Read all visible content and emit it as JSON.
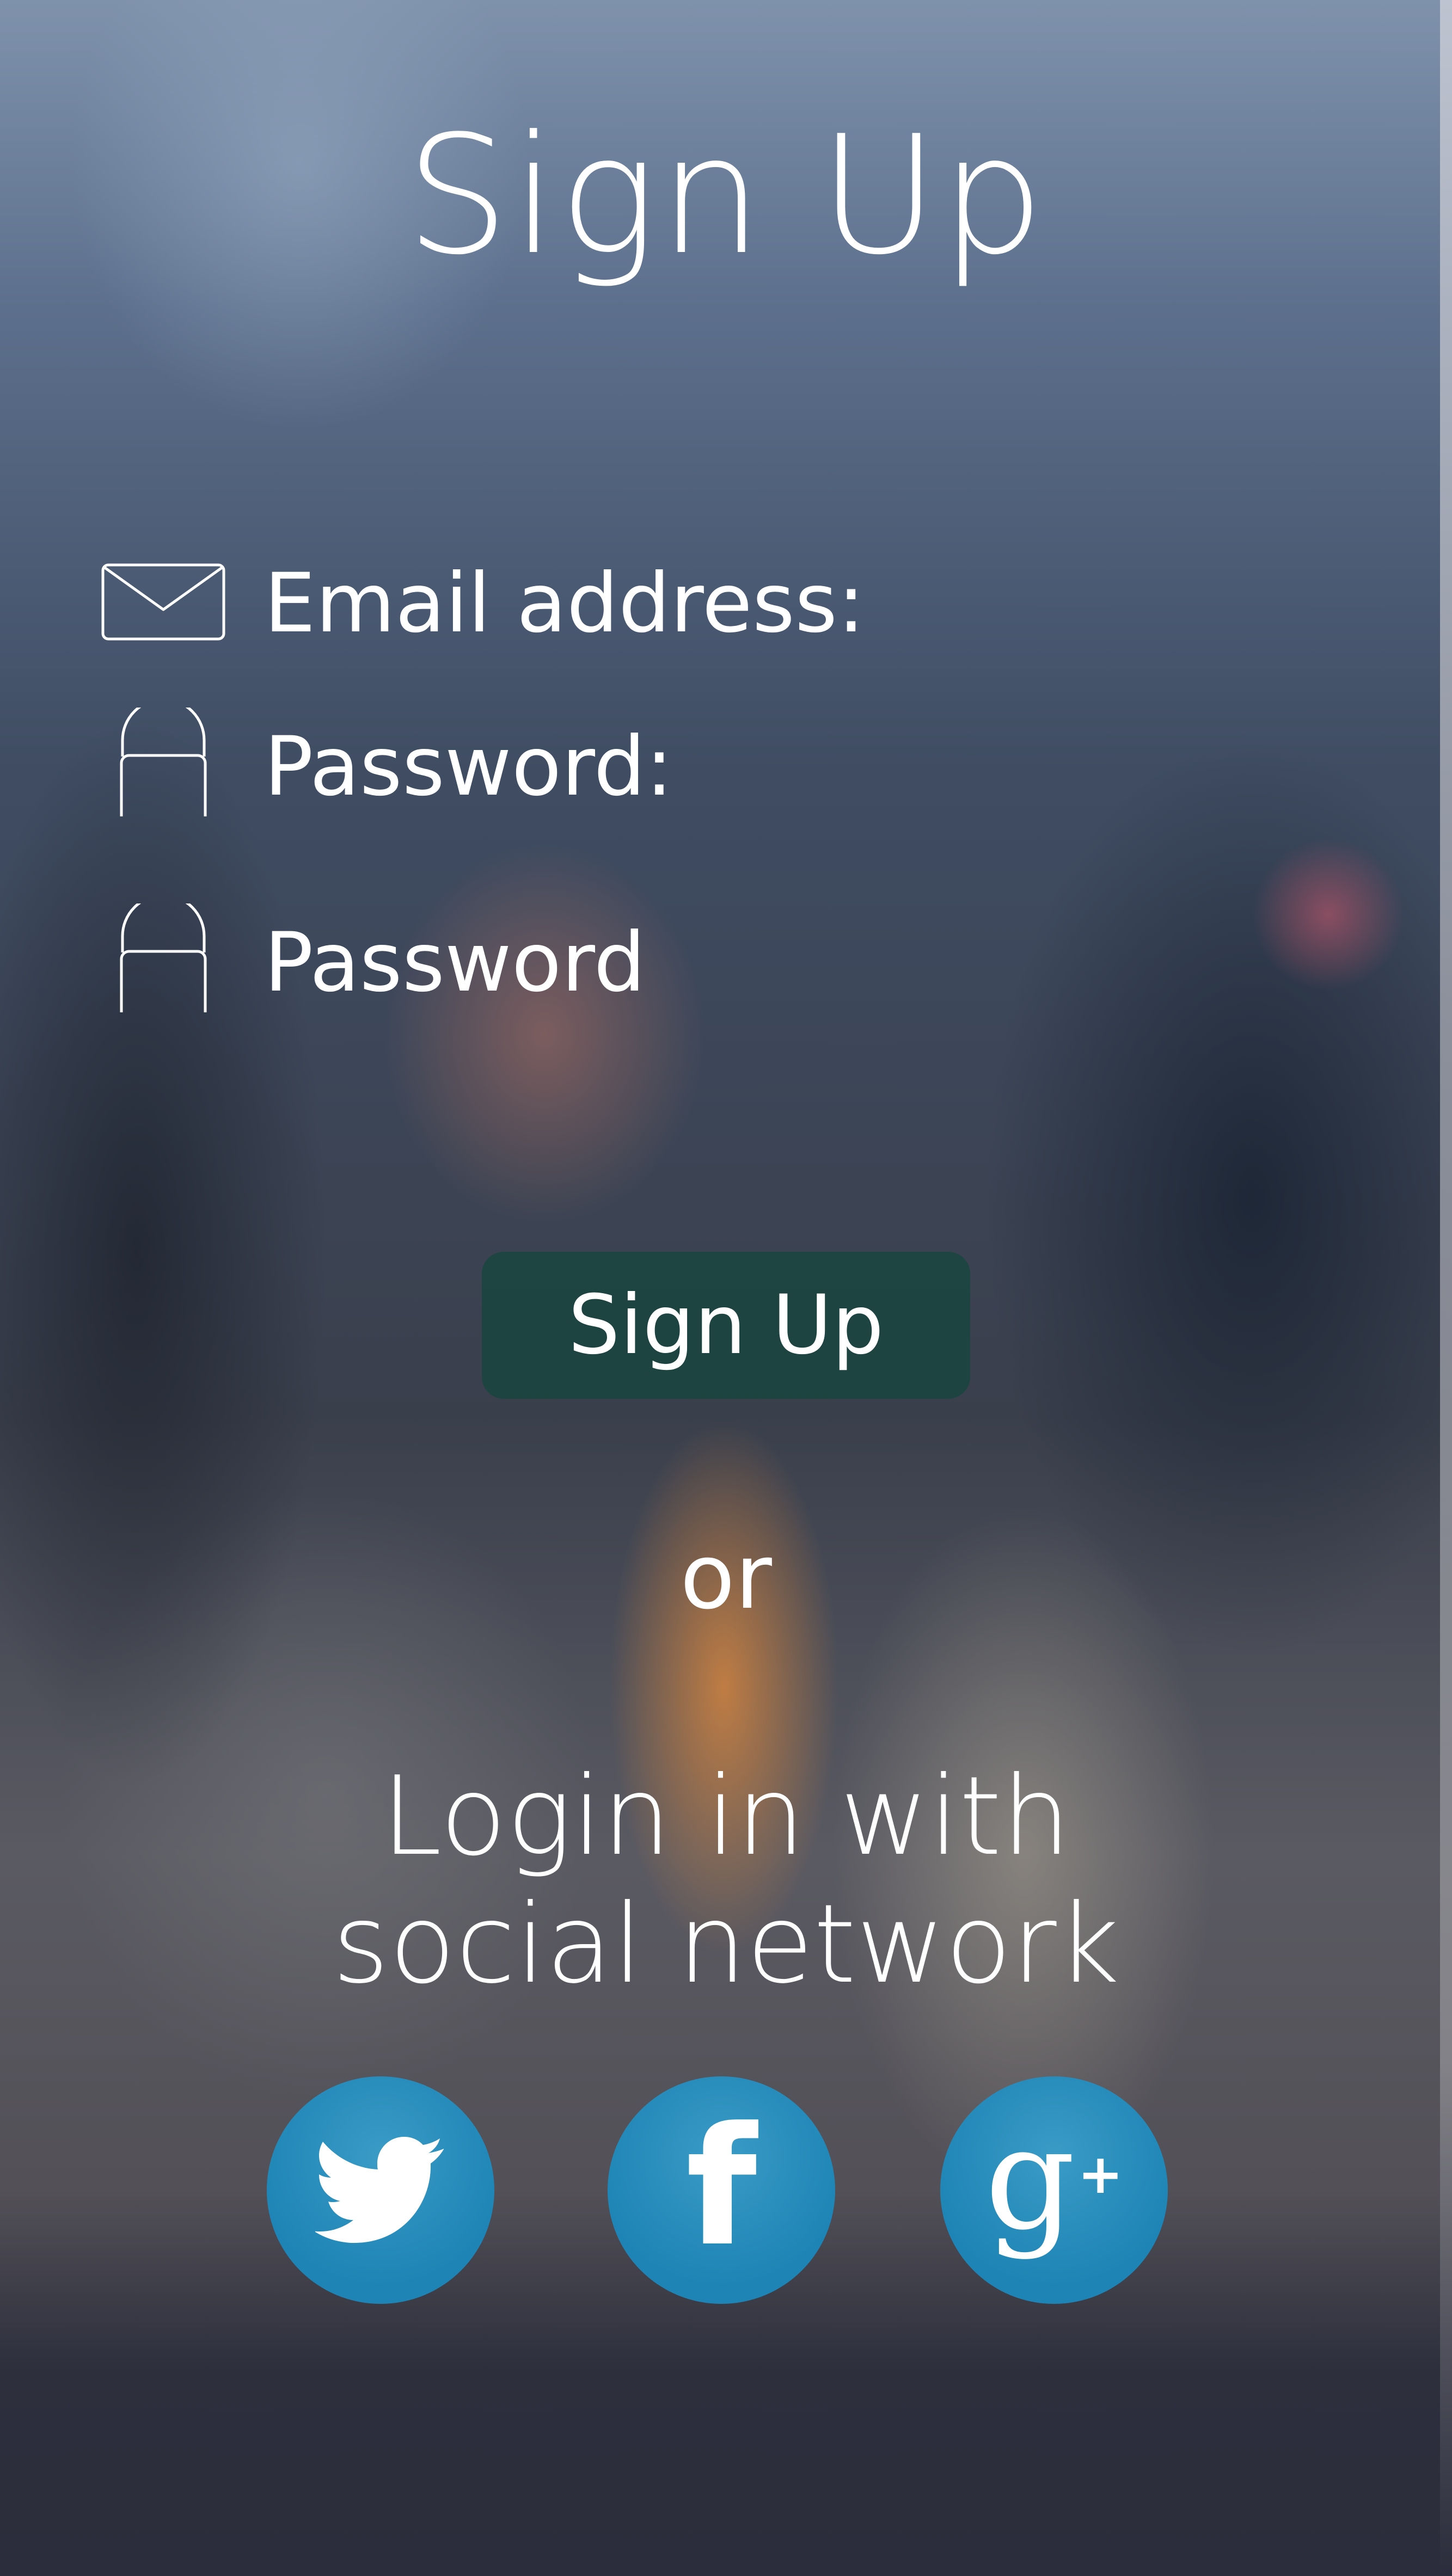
{
  "header": {
    "title": "Sign Up"
  },
  "form": {
    "fields": [
      {
        "label": "Email address:",
        "icon": "mail-icon"
      },
      {
        "label": "Password:",
        "icon": "lock-icon"
      },
      {
        "label": "Password",
        "icon": "lock-icon"
      }
    ],
    "submit_label": "Sign Up"
  },
  "divider": {
    "text": "or"
  },
  "social": {
    "line1": "Login in with",
    "line2": "social network",
    "buttons": [
      {
        "name": "twitter",
        "icon": "twitter-icon",
        "glyph": ""
      },
      {
        "name": "facebook",
        "icon": "facebook-icon",
        "glyph": "f"
      },
      {
        "name": "google-plus",
        "icon": "google-plus-icon",
        "glyph": "g",
        "plus": "+"
      }
    ]
  },
  "colors": {
    "button_bg": "#18463e",
    "social_bg": "#1d84b5",
    "text": "#ffffff"
  }
}
